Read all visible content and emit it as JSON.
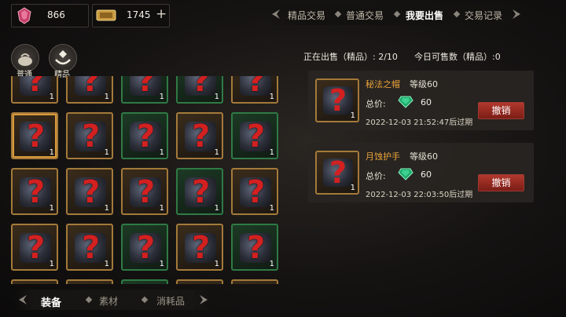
{
  "currency": {
    "ruby_amount": "866",
    "ticket_amount": "1745",
    "add_label": "+"
  },
  "tabs": [
    {
      "label": "精品交易",
      "active": false
    },
    {
      "label": "普通交易",
      "active": false
    },
    {
      "label": "我要出售",
      "active": true
    },
    {
      "label": "交易记录",
      "active": false
    }
  ],
  "categories": [
    {
      "label": "普通"
    },
    {
      "label": "精品"
    }
  ],
  "sale_status": {
    "selling_label": "正在出售（精品）: 2/10",
    "today_label": "今日可售数（精品）:0"
  },
  "listings": [
    {
      "name": "秘法之帽",
      "level": "等级60",
      "price_label": "总价:",
      "price": "60",
      "expire": "2022-12-03 21:52:47后过期",
      "count": "1",
      "cancel_label": "撤销"
    },
    {
      "name": "月蚀护手",
      "level": "等级60",
      "price_label": "总价:",
      "price": "60",
      "expire": "2022-12-03 22:03:50后过期",
      "count": "1",
      "cancel_label": "撤销"
    }
  ],
  "inventory": [
    {
      "rarity": "gold",
      "count": "1"
    },
    {
      "rarity": "gold",
      "count": "1"
    },
    {
      "rarity": "green",
      "count": "1"
    },
    {
      "rarity": "green",
      "count": "1"
    },
    {
      "rarity": "gold",
      "count": "1"
    },
    {
      "rarity": "gold",
      "count": "1"
    },
    {
      "rarity": "gold",
      "count": "1"
    },
    {
      "rarity": "green",
      "count": "1"
    },
    {
      "rarity": "gold",
      "count": "1"
    },
    {
      "rarity": "green",
      "count": "1"
    },
    {
      "rarity": "gold",
      "count": "1"
    },
    {
      "rarity": "gold",
      "count": "1"
    },
    {
      "rarity": "gold",
      "count": "1"
    },
    {
      "rarity": "green",
      "count": "1"
    },
    {
      "rarity": "gold",
      "count": "1"
    },
    {
      "rarity": "gold",
      "count": "1"
    },
    {
      "rarity": "gold",
      "count": "1"
    },
    {
      "rarity": "green",
      "count": "1"
    },
    {
      "rarity": "gold",
      "count": "1"
    },
    {
      "rarity": "green",
      "count": "1"
    },
    {
      "rarity": "gold",
      "count": ""
    },
    {
      "rarity": "gold",
      "count": ""
    },
    {
      "rarity": "green",
      "count": ""
    },
    {
      "rarity": "gold",
      "count": ""
    },
    {
      "rarity": "gold",
      "count": ""
    }
  ],
  "bottom_tabs": [
    {
      "label": "装备",
      "active": true
    },
    {
      "label": "素材",
      "active": false
    },
    {
      "label": "消耗品",
      "active": false
    }
  ],
  "colors": {
    "gold_frame": "#a47a3a",
    "green_frame": "#2f7a45",
    "item_name": "#e9a23b",
    "cancel_button": "#b2382d"
  },
  "icons": [
    "ruby-icon",
    "ticket-icon",
    "bag-icon",
    "gem-hand-icon",
    "emerald-icon",
    "question-mark-icon"
  ]
}
